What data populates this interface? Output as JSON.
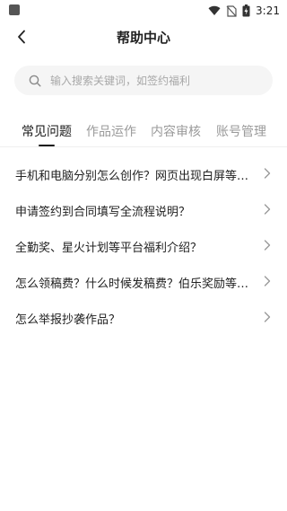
{
  "status_bar": {
    "time": "3:21"
  },
  "header": {
    "title": "帮助中心"
  },
  "search": {
    "placeholder": "输入搜索关键词，如签约福利"
  },
  "tabs": [
    {
      "label": "常见问题",
      "active": true
    },
    {
      "label": "作品运作",
      "active": false
    },
    {
      "label": "内容审核",
      "active": false
    },
    {
      "label": "账号管理",
      "active": false
    }
  ],
  "faq": [
    {
      "question": "手机和电脑分别怎么创作？网页出现白屏等问题怎么办？"
    },
    {
      "question": "申请签约到合同填写全流程说明？"
    },
    {
      "question": "全勤奖、星火计划等平台福利介绍？"
    },
    {
      "question": "怎么领稿费？什么时候发稿费？伯乐奖励等什么时候发放？"
    },
    {
      "question": "怎么举报抄袭作品？"
    }
  ],
  "colors": {
    "text": "#1f1f1f",
    "muted": "#9a9a9a",
    "search_bg": "#f5f5f5"
  }
}
